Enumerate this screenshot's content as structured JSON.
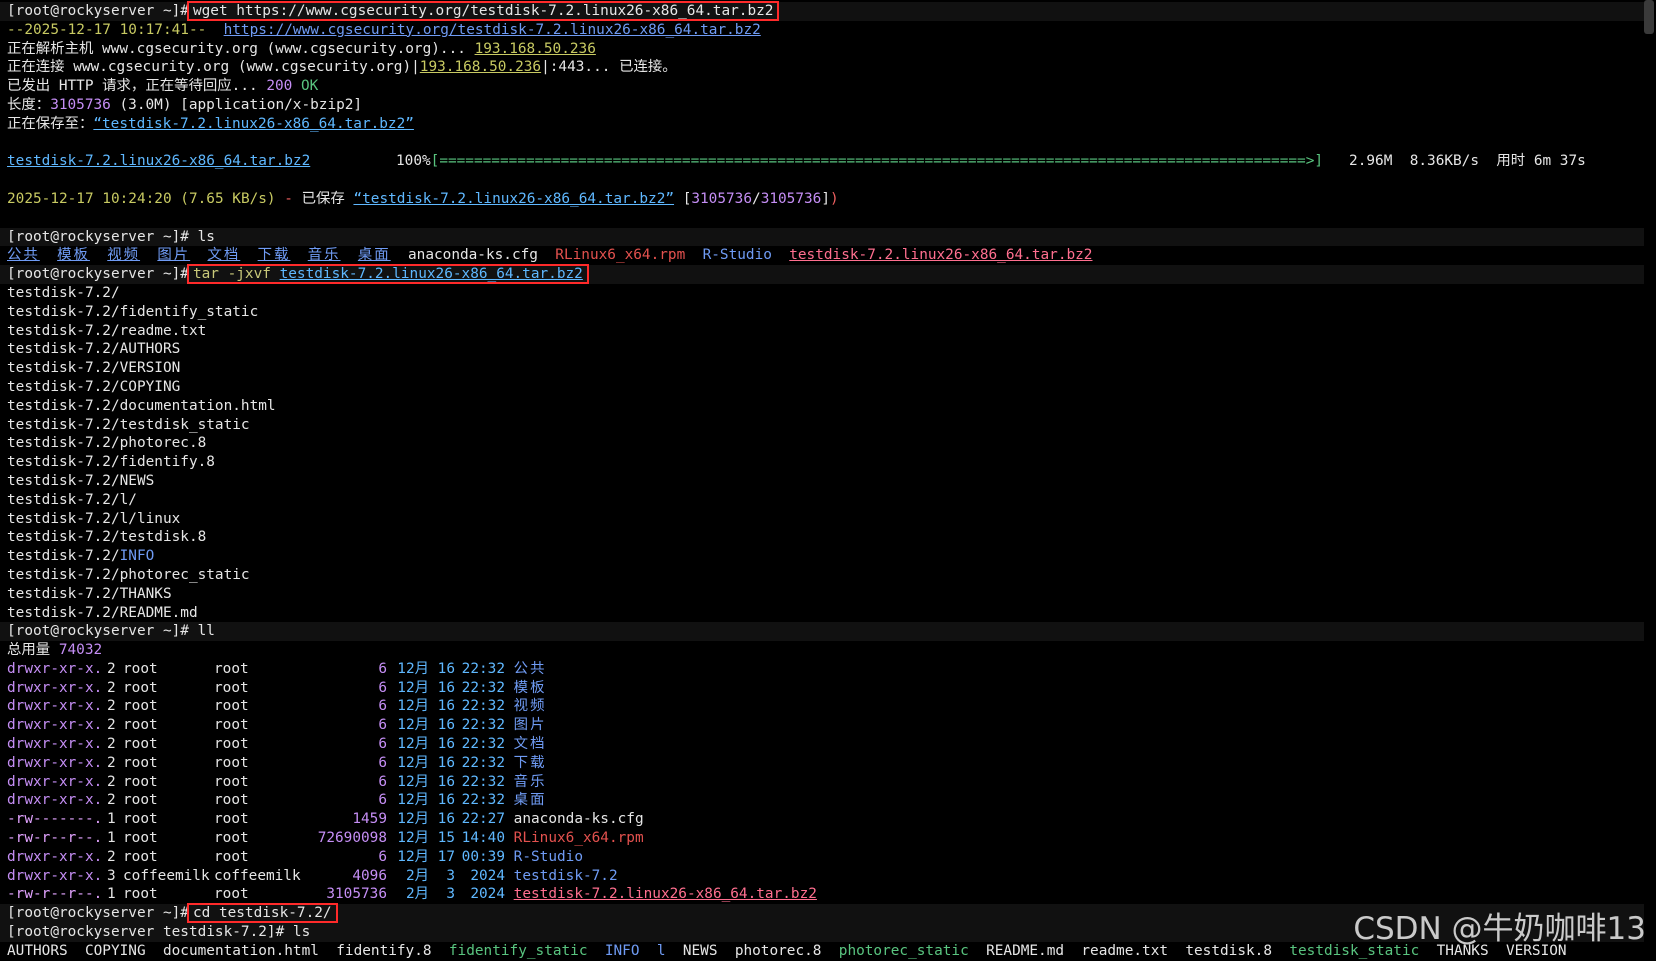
{
  "prompt": "[root@rockyserver ~]#",
  "prompt2": "[root@rockyserver testdisk-7.2]#",
  "wget": {
    "cmd": "wget https://www.cgsecurity.org/testdisk-7.2.linux26-x86_64.tar.bz2",
    "ts": "--2025-12-17 10:17:41--",
    "url": "https://www.cgsecurity.org/testdisk-7.2.linux26-x86_64.tar.bz2",
    "resolve_label": "正在解析主机 www.cgsecurity.org (www.cgsecurity.org)... ",
    "ip": "193.168.50.236",
    "connect_label": "正在连接 www.cgsecurity.org (www.cgsecurity.org)|",
    "connect_ip": "193.168.50.236",
    "connect_port": "|:443... ",
    "connected": "已连接。",
    "http_label": "已发出 HTTP 请求，正在等待回应... ",
    "http_code": "200",
    "http_ok": "OK",
    "length_label": "长度：",
    "length_val": "3105736",
    "length_rest": " (3.0M) [application/x-bzip2]",
    "saving_label": "正在保存至：",
    "saving_file": "“testdisk-7.2.linux26-x86_64.tar.bz2”",
    "progress_file": "testdisk-7.2.linux26-x86_64.tar.bz2",
    "progress_pct": "100%",
    "progress_bar": "[====================================================================================================>]",
    "progress_size": "2.96M",
    "progress_speed": "8.36KB/s",
    "progress_time_label": "用时",
    "progress_time": "6m 37s",
    "done_ts": "2025-12-17 10:24:20",
    "done_rate": "(7.65 KB/s)",
    "done_dash": " - ",
    "done_label": "已保存 ",
    "done_file": "“testdisk-7.2.linux26-x86_64.tar.bz2”",
    "done_sizes_open": " [",
    "done_size_a": "3105736",
    "done_size_sep": "/",
    "done_size_b": "3105736",
    "done_sizes_close": "]",
    "done_paren": ")"
  },
  "ls1": {
    "cmd": "ls",
    "items": [
      "公共",
      "模板",
      "视频",
      "图片",
      "文档",
      "下载",
      "音乐",
      "桌面"
    ],
    "cfg": "anaconda-ks.cfg",
    "rpm": "RLinux6_x64.rpm",
    "rstudio": "R-Studio",
    "tarball": "testdisk-7.2.linux26-x86_64.tar.bz2"
  },
  "tar": {
    "cmd_prefix": "tar -jxvf ",
    "cmd_file": "testdisk-7.2.linux26-x86_64.tar.bz2",
    "files": [
      "testdisk-7.2/",
      "testdisk-7.2/fidentify_static",
      "testdisk-7.2/readme.txt",
      "testdisk-7.2/AUTHORS",
      "testdisk-7.2/VERSION",
      "testdisk-7.2/COPYING",
      "testdisk-7.2/documentation.html",
      "testdisk-7.2/testdisk_static",
      "testdisk-7.2/photorec.8",
      "testdisk-7.2/fidentify.8",
      "testdisk-7.2/NEWS",
      "testdisk-7.2/l/",
      "testdisk-7.2/l/linux",
      "testdisk-7.2/testdisk.8"
    ],
    "info_prefix": "testdisk-7.2/",
    "info_name": "INFO",
    "files2": [
      "testdisk-7.2/photorec_static",
      "testdisk-7.2/THANKS",
      "testdisk-7.2/README.md"
    ]
  },
  "ll": {
    "cmd": "ll",
    "total_label": "总用量 ",
    "total": "74032",
    "rows": [
      {
        "perm": "drwxr-xr-x.",
        "links": "2",
        "owner": "root",
        "group": "root",
        "size": "6",
        "mon": "12月",
        "day": "16",
        "time": "22:32",
        "name": "公共",
        "kind": "dir"
      },
      {
        "perm": "drwxr-xr-x.",
        "links": "2",
        "owner": "root",
        "group": "root",
        "size": "6",
        "mon": "12月",
        "day": "16",
        "time": "22:32",
        "name": "模板",
        "kind": "dir"
      },
      {
        "perm": "drwxr-xr-x.",
        "links": "2",
        "owner": "root",
        "group": "root",
        "size": "6",
        "mon": "12月",
        "day": "16",
        "time": "22:32",
        "name": "视频",
        "kind": "dir"
      },
      {
        "perm": "drwxr-xr-x.",
        "links": "2",
        "owner": "root",
        "group": "root",
        "size": "6",
        "mon": "12月",
        "day": "16",
        "time": "22:32",
        "name": "图片",
        "kind": "dir"
      },
      {
        "perm": "drwxr-xr-x.",
        "links": "2",
        "owner": "root",
        "group": "root",
        "size": "6",
        "mon": "12月",
        "day": "16",
        "time": "22:32",
        "name": "文档",
        "kind": "dir"
      },
      {
        "perm": "drwxr-xr-x.",
        "links": "2",
        "owner": "root",
        "group": "root",
        "size": "6",
        "mon": "12月",
        "day": "16",
        "time": "22:32",
        "name": "下载",
        "kind": "dir"
      },
      {
        "perm": "drwxr-xr-x.",
        "links": "2",
        "owner": "root",
        "group": "root",
        "size": "6",
        "mon": "12月",
        "day": "16",
        "time": "22:32",
        "name": "音乐",
        "kind": "dir"
      },
      {
        "perm": "drwxr-xr-x.",
        "links": "2",
        "owner": "root",
        "group": "root",
        "size": "6",
        "mon": "12月",
        "day": "16",
        "time": "22:32",
        "name": "桌面",
        "kind": "dir"
      },
      {
        "perm": "-rw-------.",
        "links": "1",
        "owner": "root",
        "group": "root",
        "size": "1459",
        "mon": "12月",
        "day": "16",
        "time": "22:27",
        "name": "anaconda-ks.cfg",
        "kind": "file"
      },
      {
        "perm": "-rw-r--r--.",
        "links": "1",
        "owner": "root",
        "group": "root",
        "size": "72690098",
        "mon": "12月",
        "day": "15",
        "time": "14:40",
        "name": "RLinux6_x64.rpm",
        "kind": "rpm"
      },
      {
        "perm": "drwxr-xr-x.",
        "links": "2",
        "owner": "root",
        "group": "root",
        "size": "6",
        "mon": "12月",
        "day": "17",
        "time": "00:39",
        "name": "R-Studio",
        "kind": "dir"
      },
      {
        "perm": "drwxr-xr-x.",
        "links": "3",
        "owner": "coffeemilk",
        "group": "coffeemilk",
        "size": "4096",
        "mon": "2月",
        "day": "3",
        "time": "2024",
        "name": "testdisk-7.2",
        "kind": "dir"
      },
      {
        "perm": "-rw-r--r--.",
        "links": "1",
        "owner": "root",
        "group": "root",
        "size": "3105736",
        "mon": "2月",
        "day": "3",
        "time": "2024",
        "name": "testdisk-7.2.linux26-x86_64.tar.bz2",
        "kind": "archive"
      }
    ]
  },
  "cd": {
    "cmd": "cd testdisk-7.2/"
  },
  "ls2": {
    "cmd": "ls",
    "items": [
      {
        "name": "AUTHORS",
        "kind": "plain"
      },
      {
        "name": "COPYING",
        "kind": "plain"
      },
      {
        "name": "documentation.html",
        "kind": "plain"
      },
      {
        "name": "fidentify.8",
        "kind": "plain"
      },
      {
        "name": "fidentify_static",
        "kind": "exec"
      },
      {
        "name": "INFO",
        "kind": "dir"
      },
      {
        "name": "l",
        "kind": "dir"
      },
      {
        "name": "NEWS",
        "kind": "plain"
      },
      {
        "name": "photorec.8",
        "kind": "plain"
      },
      {
        "name": "photorec_static",
        "kind": "exec"
      },
      {
        "name": "README.md",
        "kind": "plain"
      },
      {
        "name": "readme.txt",
        "kind": "plain"
      },
      {
        "name": "testdisk.8",
        "kind": "plain"
      },
      {
        "name": "testdisk_static",
        "kind": "exec"
      },
      {
        "name": "THANKS",
        "kind": "plain"
      },
      {
        "name": "VERSION",
        "kind": "plain"
      }
    ]
  },
  "watermark": "CSDN @牛奶咖啡13",
  "colors": {
    "background": "#000000",
    "highlight_box": "#ff2a2a",
    "dir": "#6f9bf4",
    "exec": "#59c47f",
    "archive": "#ff6f8f"
  }
}
